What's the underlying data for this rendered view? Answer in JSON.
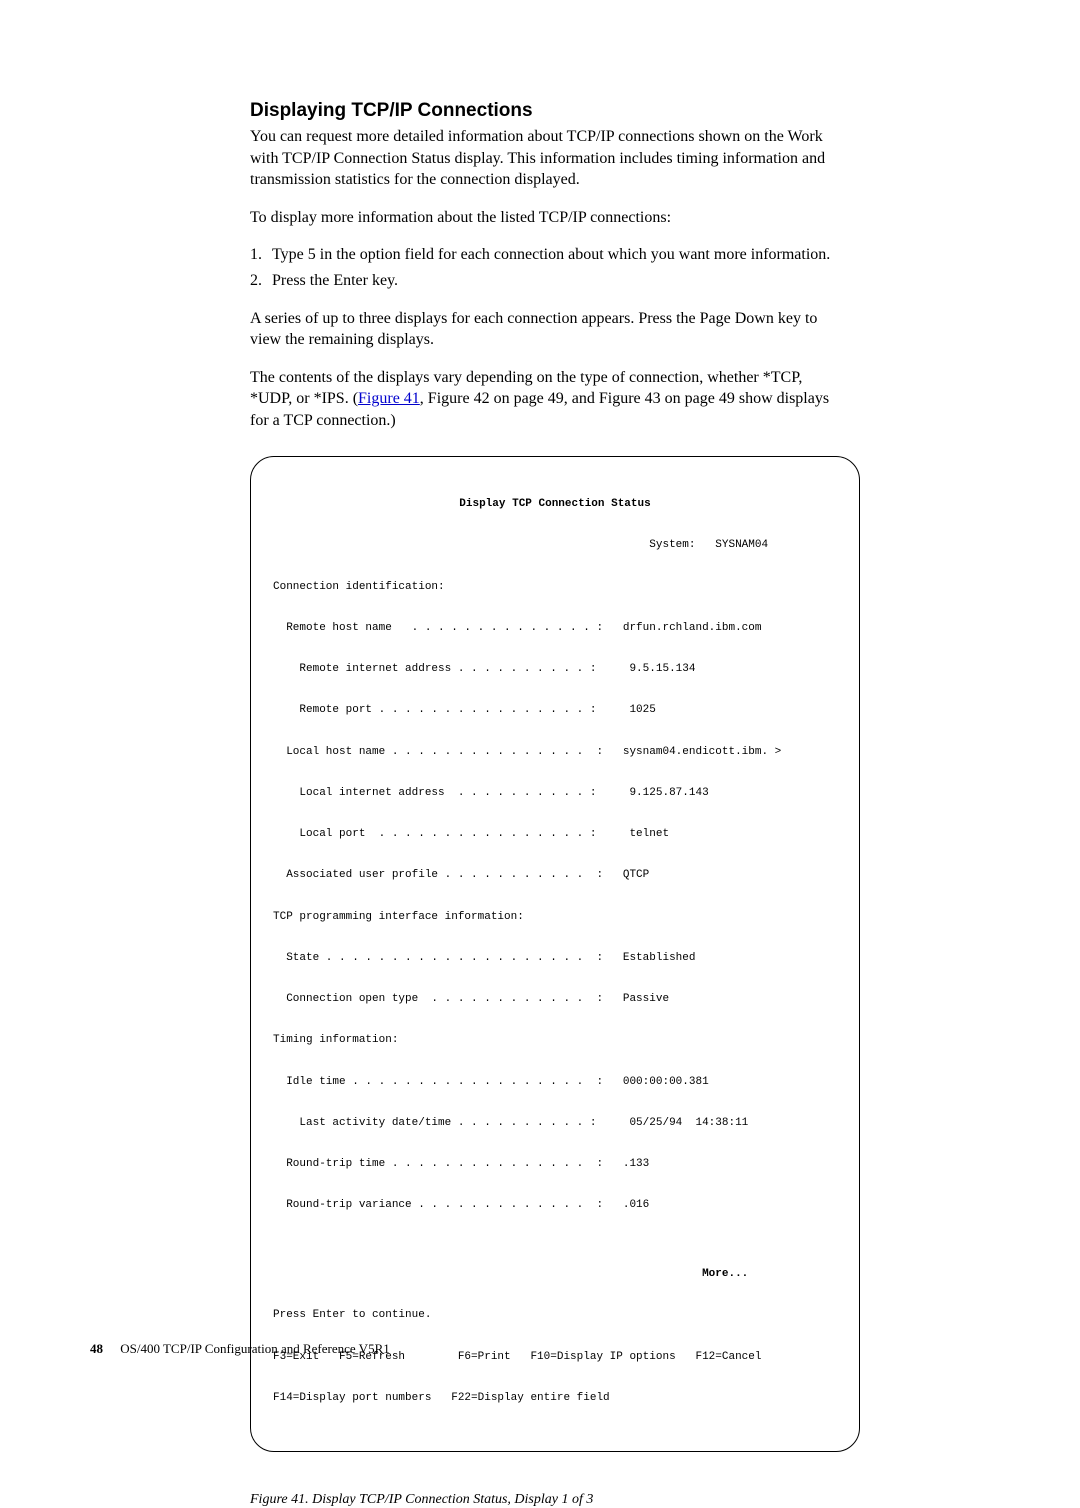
{
  "heading": "Displaying TCP/IP Connections",
  "paragraphs": {
    "p1": "You can request more detailed information about TCP/IP connections shown on the Work with TCP/IP Connection Status display. This information includes timing information and transmission statistics for the connection displayed.",
    "p2": "To display more information about the listed TCP/IP connections:",
    "p3": "A series of up to three displays for each connection appears. Press the Page Down key to view the remaining displays.",
    "p4_pre": "The contents of the displays vary depending on the type of connection, whether *TCP, *UDP, or *IPS. (",
    "p4_link": "Figure 41",
    "p4_post": ", Figure 42 on page 49, and Figure 43 on page 49 show displays for a TCP connection.)"
  },
  "steps": [
    {
      "num": "1.",
      "text": "Type 5 in the option field for each connection about which you want more information."
    },
    {
      "num": "2.",
      "text": "Press the Enter key."
    }
  ],
  "terminal": {
    "title": "Display TCP Connection Status",
    "system": "                                                         System:   SYSNAM04",
    "lines": [
      "Connection identification:",
      "  Remote host name   . . . . . . . . . . . . . . :   drfun.rchland.ibm.com",
      "    Remote internet address . . . . . . . . . . :     9.5.15.134",
      "    Remote port . . . . . . . . . . . . . . . . :     1025",
      "  Local host name . . . . . . . . . . . . . . .  :   sysnam04.endicott.ibm. >",
      "    Local internet address  . . . . . . . . . . :     9.125.87.143",
      "    Local port  . . . . . . . . . . . . . . . . :     telnet",
      "  Associated user profile . . . . . . . . . . .  :   QTCP",
      "TCP programming interface information:",
      "  State . . . . . . . . . . . . . . . . . . . .  :   Established",
      "  Connection open type  . . . . . . . . . . . .  :   Passive",
      "Timing information:",
      "  Idle time . . . . . . . . . . . . . . . . . .  :   000:00:00.381",
      "    Last activity date/time . . . . . . . . . . :     05/25/94  14:38:11",
      "  Round-trip time . . . . . . . . . . . . . . .  :   .133",
      "  Round-trip variance . . . . . . . . . . . . .  :   .016",
      ""
    ],
    "more": "                                                                 More...",
    "press_enter": "Press Enter to continue.",
    "fkeys1": "F3=Exit   F5=Refresh        F6=Print   F10=Display IP options   F12=Cancel",
    "fkeys2": "F14=Display port numbers   F22=Display entire field"
  },
  "caption": "Figure 41. Display TCP/IP Connection Status, Display 1 of 3",
  "footer": {
    "page": "48",
    "title": "OS/400 TCP/IP Configuration and Reference V5R1"
  }
}
